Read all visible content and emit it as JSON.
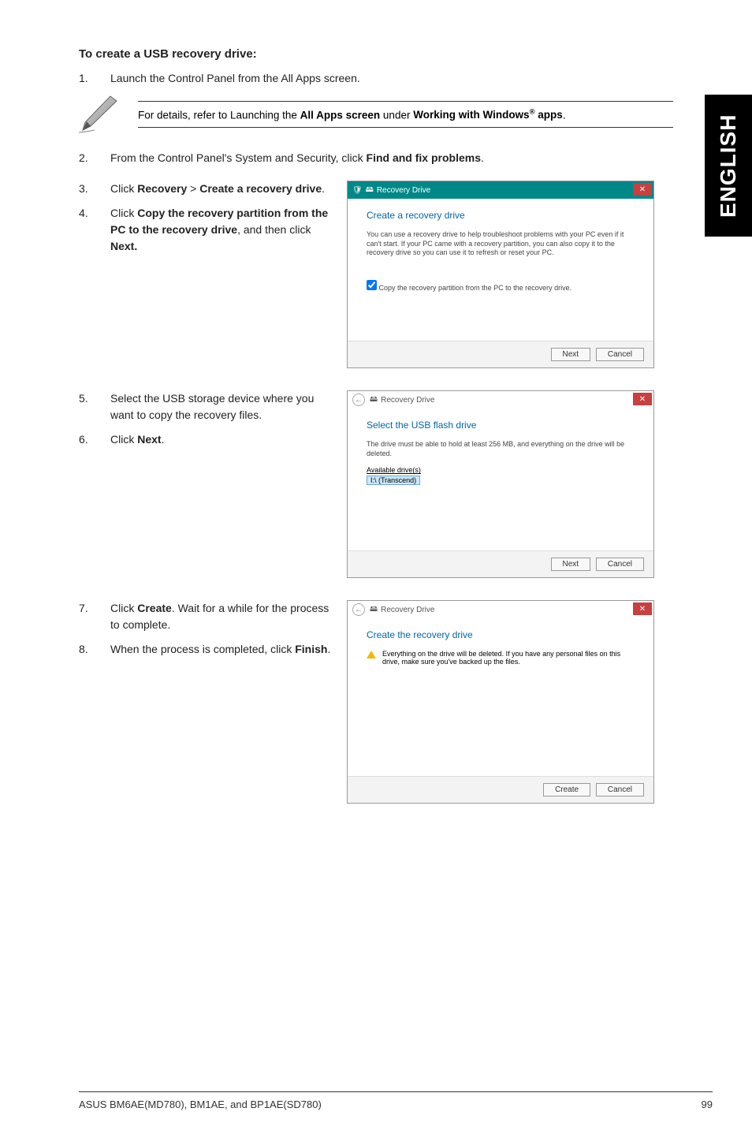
{
  "side_tab": "ENGLISH",
  "heading": "To create a USB recovery drive:",
  "step1": {
    "num": "1.",
    "text": "Launch the Control Panel from the All Apps screen."
  },
  "note": {
    "prefix": "For details, refer to Launching the ",
    "b1": "All Apps screen",
    "mid": " under ",
    "b2_a": "Working with Windows",
    "b2_sup": "®",
    "b2_b": " apps",
    "suffix": "."
  },
  "step2": {
    "num": "2.",
    "prefix": "From the Control Panel's System and Security, click ",
    "bold": "Find and fix problems",
    "suffix": "."
  },
  "step3": {
    "num": "3.",
    "prefix": "Click ",
    "b1": "Recovery",
    "gt": " > ",
    "b2": "Create a recovery drive",
    "suffix": "."
  },
  "step4": {
    "num": "4.",
    "prefix": "Click ",
    "b1": "Copy the recovery partition from the PC to the recovery drive",
    "mid": ", and then click ",
    "b2": "Next."
  },
  "step5": {
    "num": "5.",
    "text": "Select the USB storage device where you want to copy the recovery files."
  },
  "step6": {
    "num": "6.",
    "prefix": "Click ",
    "bold": "Next",
    "suffix": "."
  },
  "step7": {
    "num": "7.",
    "prefix": "Click ",
    "bold": "Create",
    "suffix": ". Wait for a while for the process to complete."
  },
  "step8": {
    "num": "8.",
    "prefix": "When the process is completed, click ",
    "bold": "Finish",
    "suffix": "."
  },
  "dlg1": {
    "title": "Recovery Drive",
    "heading": "Create a recovery drive",
    "desc": "You can use a recovery drive to help troubleshoot problems with your PC even if it can't start. If your PC came with a recovery partition, you can also copy it to the recovery drive so you can use it to refresh or reset your PC.",
    "check": "Copy the recovery partition from the PC to the recovery drive.",
    "next": "Next",
    "cancel": "Cancel"
  },
  "dlg2": {
    "title": "Recovery Drive",
    "heading": "Select the USB flash drive",
    "desc": "The drive must be able to hold at least 256 MB, and everything on the drive will be deleted.",
    "avail_label": "Available drive(s)",
    "avail_item": "I:\\ (Transcend)",
    "next": "Next",
    "cancel": "Cancel"
  },
  "dlg3": {
    "title": "Recovery Drive",
    "heading": "Create the recovery drive",
    "warn": "Everything on the drive will be deleted. If you have any personal files on this drive, make sure you've backed up the files.",
    "create": "Create",
    "cancel": "Cancel"
  },
  "footer": {
    "left": "ASUS BM6AE(MD780), BM1AE, and BP1AE(SD780)",
    "right": "99"
  }
}
